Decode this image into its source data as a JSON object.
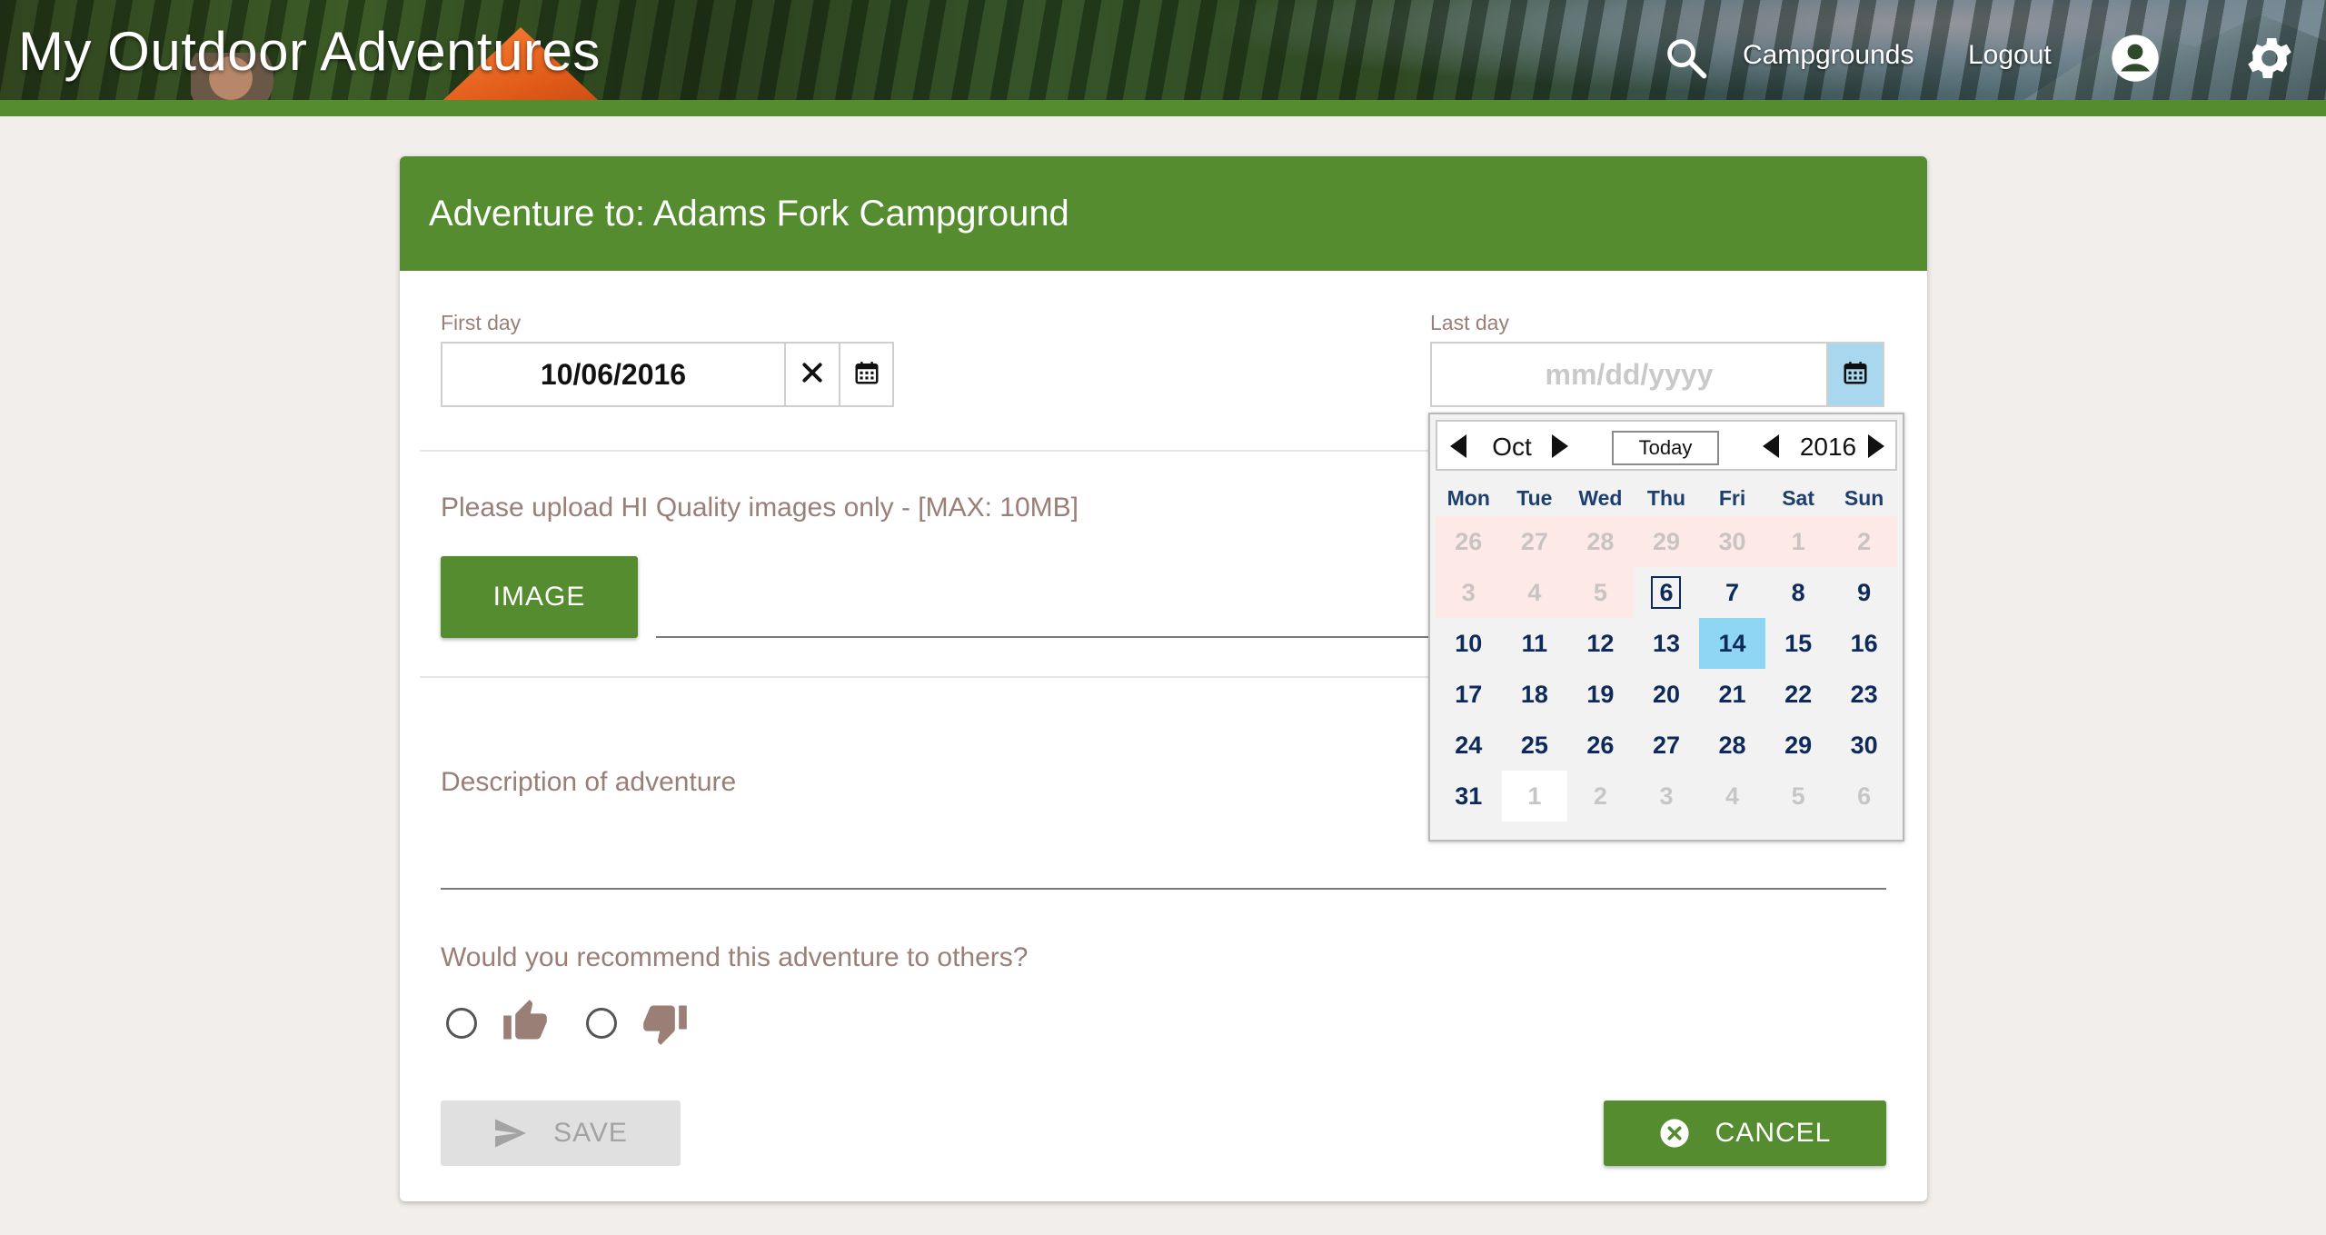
{
  "header": {
    "app_title": "My Outdoor Adventures",
    "nav": {
      "campgrounds": "Campgrounds",
      "logout": "Logout"
    },
    "icons": [
      "search-icon",
      "account-icon",
      "settings-icon"
    ]
  },
  "form": {
    "title": "Adventure to: Adams Fork Campground",
    "first_day": {
      "label": "First day",
      "value": "10/06/2016"
    },
    "last_day": {
      "label": "Last day",
      "value": "",
      "placeholder": "mm/dd/yyyy"
    },
    "upload_hint": "Please upload HI Quality images only - [MAX: 10MB]",
    "image_button": "IMAGE",
    "description_label": "Description of adventure",
    "recommend_question": "Would you recommend this adventure to others?",
    "save_button": "SAVE",
    "cancel_button": "CANCEL"
  },
  "calendar": {
    "month": "Oct",
    "year": "2016",
    "today_button": "Today",
    "weekdays": [
      "Mon",
      "Tue",
      "Wed",
      "Thu",
      "Fri",
      "Sat",
      "Sun"
    ],
    "weeks": [
      [
        "26",
        "27",
        "28",
        "29",
        "30",
        "1",
        "2"
      ],
      [
        "3",
        "4",
        "5",
        "6",
        "7",
        "8",
        "9"
      ],
      [
        "10",
        "11",
        "12",
        "13",
        "14",
        "15",
        "16"
      ],
      [
        "17",
        "18",
        "19",
        "20",
        "21",
        "22",
        "23"
      ],
      [
        "24",
        "25",
        "26",
        "27",
        "28",
        "29",
        "30"
      ],
      [
        "31",
        "1",
        "2",
        "3",
        "4",
        "5",
        "6"
      ]
    ],
    "selected_day": "6",
    "highlighted_day": "14"
  },
  "colors": {
    "brand_green": "#548c2f",
    "muted_text": "#9a7f77",
    "calendar_day": "#0d2a5a",
    "highlight": "#8fd6f5"
  }
}
